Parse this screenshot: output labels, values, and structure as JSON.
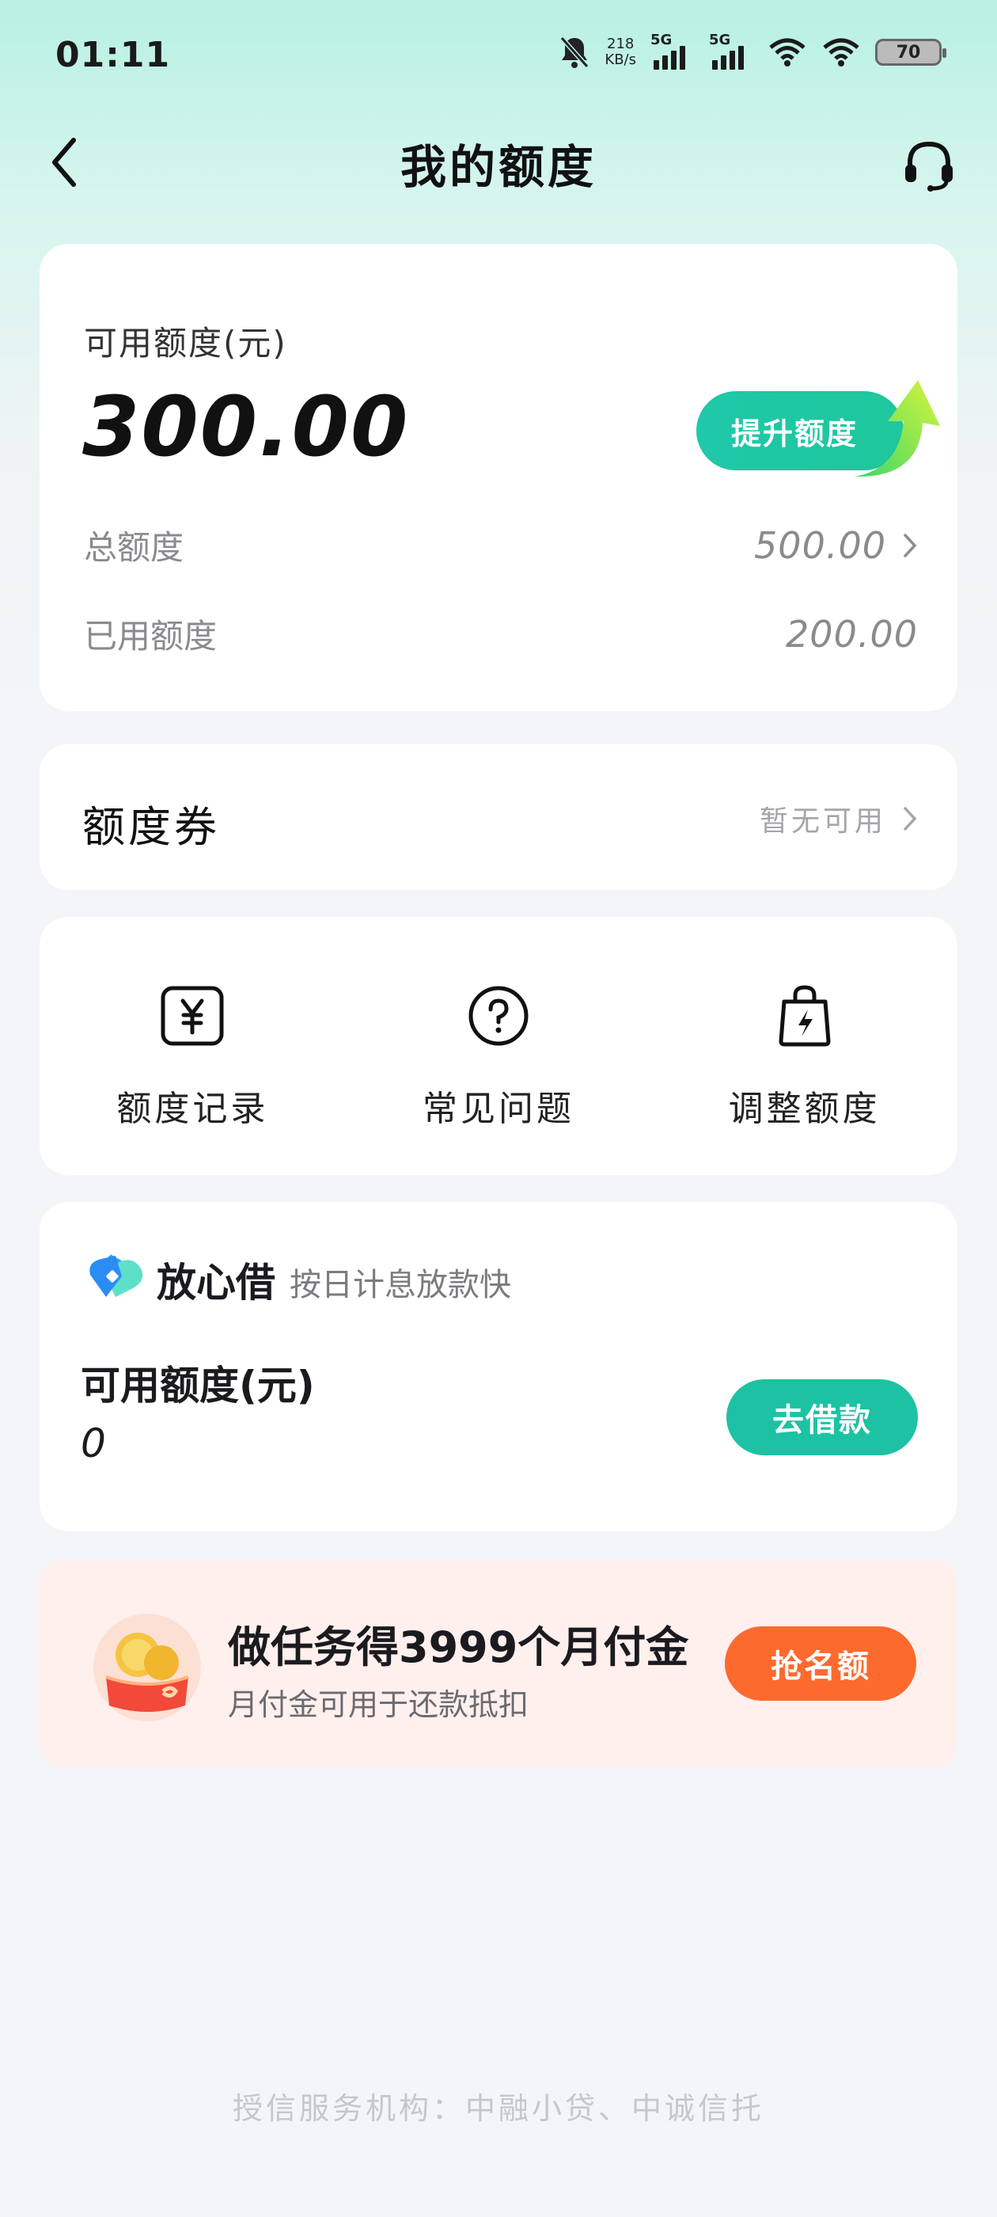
{
  "status_bar": {
    "time": "01:11",
    "speed_value": "218",
    "speed_unit": "KB/s",
    "net1": "5G",
    "net2": "5G",
    "battery": "70"
  },
  "header": {
    "title": "我的额度"
  },
  "credit": {
    "available_label": "可用额度(元)",
    "available_value": "300.00",
    "raise_button": "提升额度",
    "total_label": "总额度",
    "total_value": "500.00",
    "used_label": "已用额度",
    "used_value": "200.00"
  },
  "coupon": {
    "label": "额度券",
    "status": "暂无可用"
  },
  "actions": [
    {
      "label": "额度记录",
      "icon": "yuan-receipt-icon"
    },
    {
      "label": "常见问题",
      "icon": "question-circle-icon"
    },
    {
      "label": "调整额度",
      "icon": "bag-lightning-icon"
    }
  ],
  "loan": {
    "brand": "放心借",
    "slogan": "按日计息放款快",
    "available_label": "可用额度(元)",
    "available_value": "0",
    "button": "去借款"
  },
  "promo": {
    "title": "做任务得3999个月付金",
    "subtitle": "月付金可用于还款抵扣",
    "button": "抢名额"
  },
  "footer": {
    "text": "授信服务机构：中融小贷、中诚信托"
  },
  "colors": {
    "accent_teal": "#1cc2a3",
    "promo_orange": "#fd6a2d",
    "promo_bg": "#fff0ee"
  }
}
